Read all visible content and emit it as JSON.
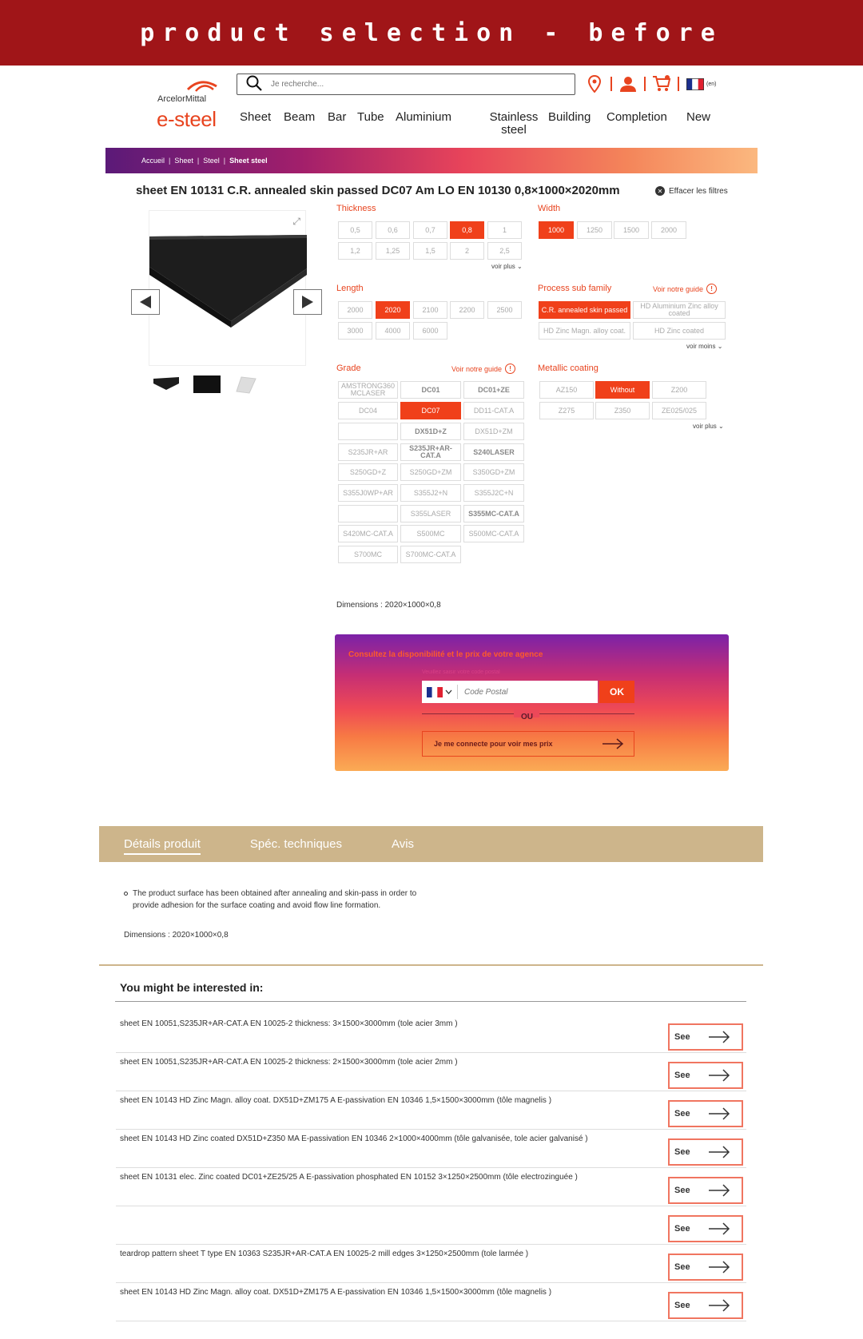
{
  "banner": {
    "text": "product selection - before"
  },
  "header": {
    "brand": "ArcelorMittal",
    "site": "e-steel",
    "search_placeholder": "Je recherche...",
    "lang": "(en)",
    "nav": [
      "Sheet",
      "Beam",
      "Bar",
      "Tube",
      "Aluminium",
      "Stainless steel",
      "Building",
      "Completion",
      "New"
    ]
  },
  "breadcrumb": [
    "Accueil",
    "Sheet",
    "Steel",
    "Sheet steel"
  ],
  "product": {
    "title": "sheet EN 10131 C.R. annealed skin passed DC07 Am LO EN 10130 0,8×1000×2020mm",
    "clear_filters": "Effacer les filtres",
    "expand_icon": "expand-icon"
  },
  "filters": {
    "thickness": {
      "label": "Thickness",
      "options": [
        "0,5",
        "0,6",
        "0,7",
        "0,8",
        "1",
        "1,2",
        "1,25",
        "1,5",
        "2",
        "2,5"
      ],
      "selected": "0,8",
      "more": "voir plus"
    },
    "width": {
      "label": "Width",
      "options": [
        "1000",
        "1250",
        "1500",
        "2000"
      ],
      "selected": "1000"
    },
    "length": {
      "label": "Length",
      "options": [
        "2000",
        "2020",
        "2100",
        "2200",
        "2500",
        "3000",
        "4000",
        "6000"
      ],
      "selected": "2020"
    },
    "process": {
      "label": "Process sub family",
      "guide": "Voir notre guide",
      "options": [
        "C.R. annealed skin passed",
        "HD Aluminium Zinc alloy coated",
        "HD Zinc Magn. alloy coat.",
        "HD Zinc coated"
      ],
      "selected": "C.R. annealed skin passed",
      "more": "voir moins"
    },
    "grade": {
      "label": "Grade",
      "guide": "Voir notre guide",
      "options": [
        "AMSTRONG360 MCLASER",
        "DC01",
        "DC01+ZE",
        "DC04",
        "DC07",
        "DD11-CAT.A",
        "",
        "DX51D+Z",
        "DX51D+ZM",
        "S235JR+AR",
        "S235JR+AR-CAT.A",
        "S240LASER",
        "S250GD+Z",
        "S250GD+ZM",
        "S350GD+ZM",
        "S355J0WP+AR",
        "S355J2+N",
        "S355J2C+N",
        "",
        "S355LASER",
        "S355MC-CAT.A",
        "S420MC-CAT.A",
        "S500MC",
        "S500MC-CAT.A",
        "S700MC",
        "S700MC-CAT.A"
      ],
      "selected": "DC07"
    },
    "coating": {
      "label": "Metallic coating",
      "options": [
        "AZ150",
        "Without",
        "Z200",
        "Z275",
        "Z350",
        "ZE025/025"
      ],
      "selected": "Without",
      "more": "voir plus"
    }
  },
  "dimensions": "Dimensions : 2020×1000×0,8",
  "availability": {
    "title": "Consultez la disponibilité et le prix de votre agence",
    "hint": "Veuillez saisir votre code postal",
    "postal_placeholder": "Code Postal",
    "ok": "OK",
    "or": "OU",
    "login": "Je me connecte pour voir mes prix"
  },
  "tabs": [
    "Détails produit",
    "Spéc. techniques",
    "Avis"
  ],
  "details": {
    "text": "The product surface has been obtained after annealing and skin-pass in order to provide adhesion for the surface coating and avoid flow line formation.",
    "dimensions": "Dimensions : 2020×1000×0,8"
  },
  "related": {
    "title": "You might be interested in:",
    "see_label": "See",
    "items": [
      "sheet EN 10051,S235JR+AR-CAT.A EN 10025-2 thickness: 3×1500×3000mm (tole acier 3mm )",
      "sheet EN 10051,S235JR+AR-CAT.A EN 10025-2 thickness: 2×1500×3000mm (tole acier 2mm )",
      "sheet EN 10143 HD Zinc Magn. alloy coat. DX51D+ZM175 A E-passivation EN 10346 1,5×1500×3000mm (tôle magnelis )",
      "sheet EN 10143 HD Zinc coated DX51D+Z350 MA E-passivation EN 10346 2×1000×4000mm (tôle galvanisée, tole acier galvanisé )",
      "sheet EN 10131 elec. Zinc coated DC01+ZE25/25 A E-passivation phosphated EN 10152 3×1250×2500mm (tôle electrozinguée )",
      "",
      "teardrop pattern sheet T type EN 10363 S235JR+AR-CAT.A EN 10025-2 mill edges 3×1250×2500mm (tole larmée )",
      "sheet EN 10143 HD Zinc Magn. alloy coat. DX51D+ZM175 A E-passivation EN 10346 1,5×1500×3000mm (tôle magnelis )"
    ]
  },
  "colors": {
    "brand": "#e8441f",
    "banner": "#a01518",
    "tabs": "#cdb58b"
  }
}
